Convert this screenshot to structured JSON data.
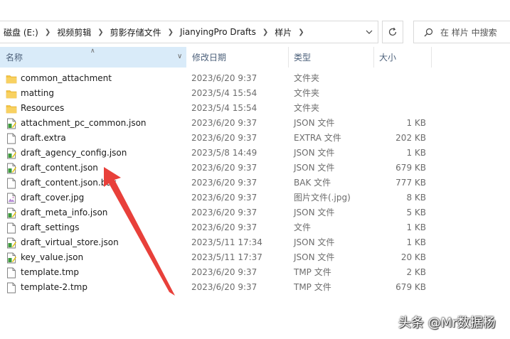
{
  "address_bar": {
    "crumbs": [
      {
        "label": "磁盘 (E:)"
      },
      {
        "label": "视频剪辑"
      },
      {
        "label": "剪影存储文件"
      },
      {
        "label": "JianyingPro Drafts"
      },
      {
        "label": "样片"
      }
    ]
  },
  "search": {
    "placeholder": "在 样片 中搜索"
  },
  "columns": {
    "name": "名称",
    "date": "修改日期",
    "type": "类型",
    "size": "大小"
  },
  "files": [
    {
      "name": "common_attachment",
      "date": "2023/6/20 9:37",
      "type": "文件夹",
      "size": "",
      "icon": "folder-icon"
    },
    {
      "name": "matting",
      "date": "2023/5/4 15:54",
      "type": "文件夹",
      "size": "",
      "icon": "folder-icon"
    },
    {
      "name": "Resources",
      "date": "2023/5/4 15:54",
      "type": "文件夹",
      "size": "",
      "icon": "folder-icon"
    },
    {
      "name": "attachment_pc_common.json",
      "date": "2023/6/20 9:37",
      "type": "JSON 文件",
      "size": "1 KB",
      "icon": "json-file-icon"
    },
    {
      "name": "draft.extra",
      "date": "2023/6/20 9:37",
      "type": "EXTRA 文件",
      "size": "202 KB",
      "icon": "file-icon"
    },
    {
      "name": "draft_agency_config.json",
      "date": "2023/5/8 14:49",
      "type": "JSON 文件",
      "size": "1 KB",
      "icon": "json-file-icon"
    },
    {
      "name": "draft_content.json",
      "date": "2023/6/20 9:37",
      "type": "JSON 文件",
      "size": "679 KB",
      "icon": "json-file-icon"
    },
    {
      "name": "draft_content.json.bak",
      "date": "2023/6/20 9:37",
      "type": "BAK 文件",
      "size": "777 KB",
      "icon": "file-icon"
    },
    {
      "name": "draft_cover.jpg",
      "date": "2023/6/20 9:37",
      "type": "图片文件(.jpg)",
      "size": "8 KB",
      "icon": "image-file-icon"
    },
    {
      "name": "draft_meta_info.json",
      "date": "2023/6/20 9:37",
      "type": "JSON 文件",
      "size": "5 KB",
      "icon": "json-file-icon"
    },
    {
      "name": "draft_settings",
      "date": "2023/6/20 9:37",
      "type": "文件",
      "size": "1 KB",
      "icon": "file-icon"
    },
    {
      "name": "draft_virtual_store.json",
      "date": "2023/5/11 17:34",
      "type": "JSON 文件",
      "size": "1 KB",
      "icon": "json-file-icon"
    },
    {
      "name": "key_value.json",
      "date": "2023/5/11 17:37",
      "type": "JSON 文件",
      "size": "20 KB",
      "icon": "json-file-icon"
    },
    {
      "name": "template.tmp",
      "date": "2023/6/20 9:37",
      "type": "TMP 文件",
      "size": "2 KB",
      "icon": "file-icon"
    },
    {
      "name": "template-2.tmp",
      "date": "2023/6/20 9:37",
      "type": "TMP 文件",
      "size": "679 KB",
      "icon": "file-icon"
    }
  ],
  "watermark": "头条 @Mr数据杨",
  "colors": {
    "header_selected_bg": "#d9ebf9",
    "folder": "#f5c442",
    "arrow": "#e8403a",
    "secondary_text": "#6d6d6d"
  }
}
